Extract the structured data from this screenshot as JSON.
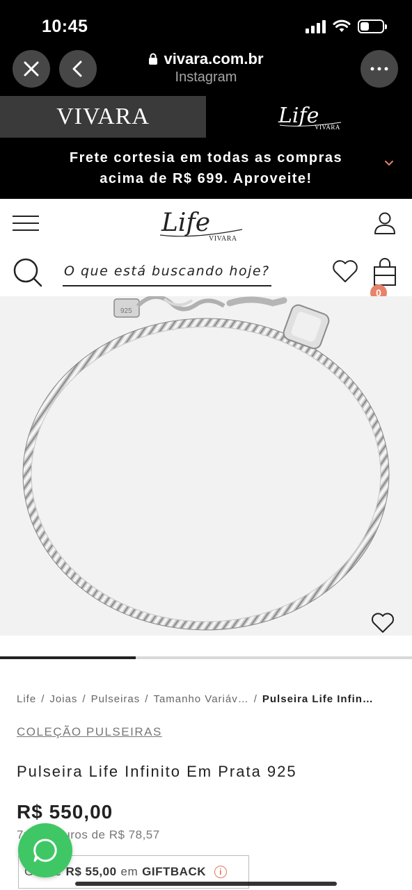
{
  "status_bar": {
    "time": "10:45"
  },
  "browser": {
    "url": "vivara.com.br",
    "source": "Instagram"
  },
  "brands": {
    "vivara": "VIVARA",
    "life_script": "Life",
    "life_sub": "VIVARA"
  },
  "promo": {
    "line1": "Frete cortesia em todas as compras",
    "line2": "acima de R$ 699. Aproveite!"
  },
  "header": {
    "logo_script": "Life",
    "logo_sub": "VIVARA"
  },
  "search": {
    "placeholder": "O que está buscando hoje?"
  },
  "cart": {
    "count": "0"
  },
  "gallery": {
    "progress": 0.33
  },
  "breadcrumb": [
    "Life",
    "Joias",
    "Pulseiras",
    "Tamanho Variáv…",
    "Pulseira Life Infin…"
  ],
  "product": {
    "collection": "COLEÇÃO PULSEIRAS",
    "title": "Pulseira Life Infinito Em Prata 925",
    "price": "R$ 550,00",
    "installments": "7x sem juros de R$ 78,57",
    "giftback_prefix": "Ganhe",
    "giftback_amount": "R$ 55,00",
    "giftback_mid": "em",
    "giftback_label": "GIFTBACK"
  },
  "colors": {
    "accent": "#e8826a",
    "whatsapp": "#3fc765",
    "chrome": "#000000"
  }
}
